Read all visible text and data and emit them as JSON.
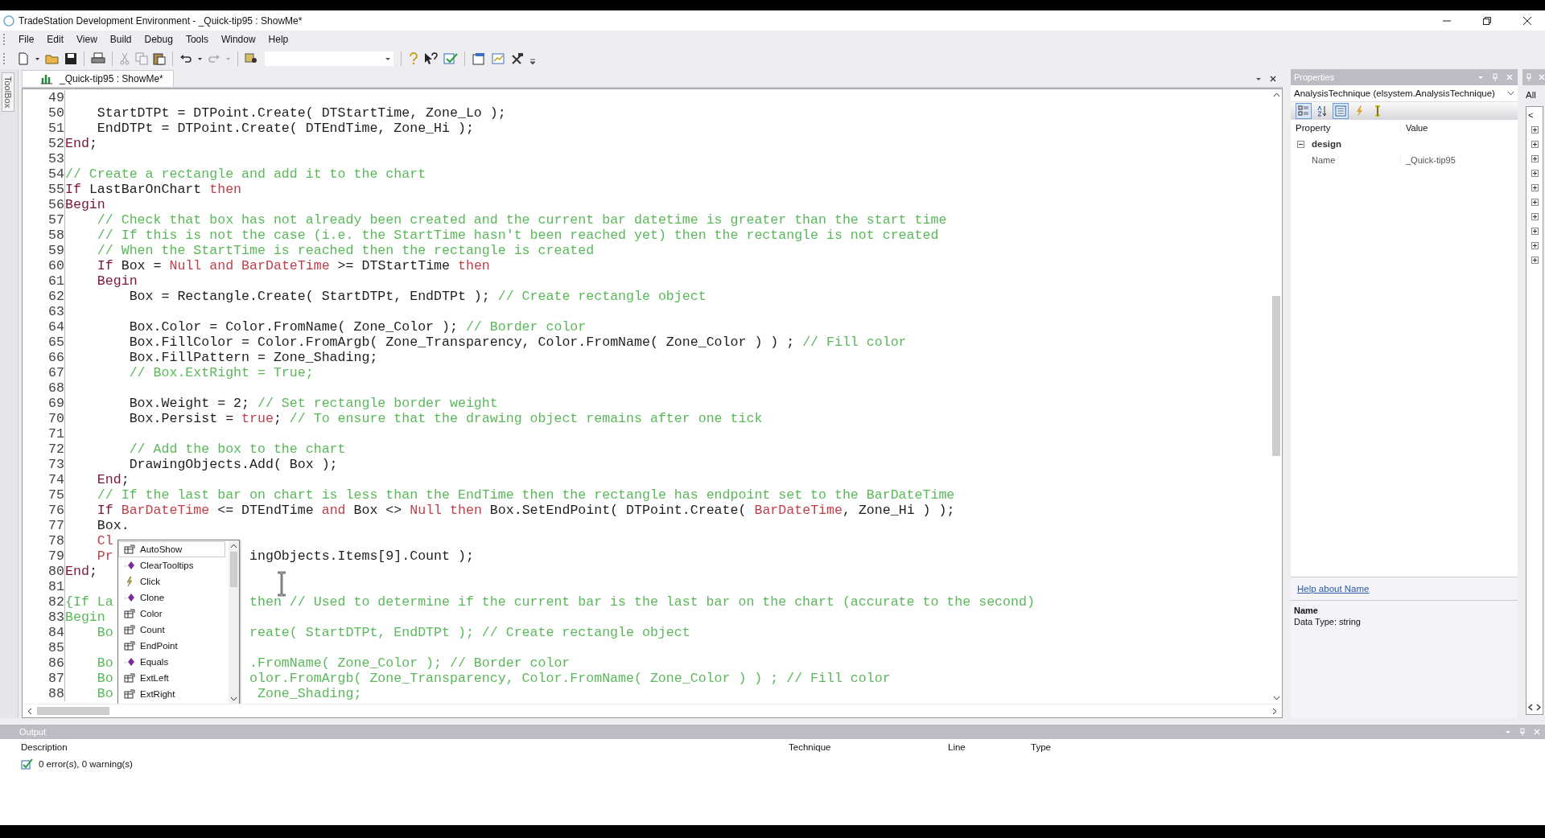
{
  "window": {
    "title": "TradeStation Development Environment - _Quick-tip95 : ShowMe*"
  },
  "menu": [
    "File",
    "Edit",
    "View",
    "Build",
    "Debug",
    "Tools",
    "Window",
    "Help"
  ],
  "toolbox": {
    "label": "ToolBox"
  },
  "editor": {
    "tab": {
      "label": "_Quick-tip95 : ShowMe*",
      "selected": true
    },
    "lines": [
      {
        "number": "49"
      },
      {
        "number": "50",
        "segments": [
          {
            "text": "    StartDTPt = DTPoint.Create( DTStartTime, Zone_Lo );",
            "kind": "code"
          }
        ]
      },
      {
        "number": "51",
        "segments": [
          {
            "text": "    EndDTPt = DTPoint.Create( DTEndTime, Zone_Hi );",
            "kind": "code"
          }
        ]
      },
      {
        "number": "52",
        "segments": [
          {
            "text": "End",
            "kind": "keyword"
          },
          {
            "text": ";",
            "kind": "code"
          }
        ]
      },
      {
        "number": "53"
      },
      {
        "number": "54",
        "segments": [
          {
            "text": "// Create a rectangle and add it to the chart",
            "kind": "comment"
          }
        ]
      },
      {
        "number": "55",
        "segments": [
          {
            "text": "If",
            "kind": "keyword"
          },
          {
            "text": " LastBarOnChart ",
            "kind": "code"
          },
          {
            "text": "then",
            "kind": "reserved"
          }
        ]
      },
      {
        "number": "56",
        "segments": [
          {
            "text": "Begin",
            "kind": "keyword"
          }
        ]
      },
      {
        "number": "57",
        "segments": [
          {
            "text": "    // Check that box has not already been created and the current bar datetime is greater than the start time",
            "kind": "comment"
          }
        ]
      },
      {
        "number": "58",
        "segments": [
          {
            "text": "    // If this is not the case (i.e. the StartTime hasn't been reached yet) then the rectangle is not created",
            "kind": "comment"
          }
        ]
      },
      {
        "number": "59",
        "segments": [
          {
            "text": "    // When the StartTime is reached then the rectangle is created",
            "kind": "comment"
          }
        ]
      },
      {
        "number": "60",
        "segments": [
          {
            "text": "    If",
            "kind": "keyword"
          },
          {
            "text": " Box = ",
            "kind": "code"
          },
          {
            "text": "Null and BarDateTime",
            "kind": "reserved"
          },
          {
            "text": " >= DTStartTime ",
            "kind": "code"
          },
          {
            "text": "then",
            "kind": "reserved"
          }
        ]
      },
      {
        "number": "61",
        "segments": [
          {
            "text": "    Begin",
            "kind": "keyword"
          }
        ]
      },
      {
        "number": "62",
        "segments": [
          {
            "text": "        Box = Rectangle.Create( StartDTPt, EndDTPt ); ",
            "kind": "code"
          },
          {
            "text": "// Create rectangle object",
            "kind": "comment"
          }
        ]
      },
      {
        "number": "63"
      },
      {
        "number": "64",
        "segments": [
          {
            "text": "        Box.Color = Color.FromName( Zone_Color ); ",
            "kind": "code"
          },
          {
            "text": "// Border color",
            "kind": "comment"
          }
        ]
      },
      {
        "number": "65",
        "segments": [
          {
            "text": "        Box.FillColor = Color.FromArgb( Zone_Transparency, Color.FromName( Zone_Color ) ) ; ",
            "kind": "code"
          },
          {
            "text": "// Fill color",
            "kind": "comment"
          }
        ]
      },
      {
        "number": "66",
        "segments": [
          {
            "text": "        Box.FillPattern = Zone_Shading;",
            "kind": "code"
          }
        ]
      },
      {
        "number": "67",
        "segments": [
          {
            "text": "        // Box.ExtRight = True;",
            "kind": "comment"
          }
        ]
      },
      {
        "number": "68"
      },
      {
        "number": "69",
        "segments": [
          {
            "text": "        Box.Weight = 2; ",
            "kind": "code"
          },
          {
            "text": "// Set rectangle border weight",
            "kind": "comment"
          }
        ]
      },
      {
        "number": "70",
        "segments": [
          {
            "text": "        Box.Persist = ",
            "kind": "code"
          },
          {
            "text": "true",
            "kind": "reserved"
          },
          {
            "text": "; ",
            "kind": "code"
          },
          {
            "text": "// To ensure that the drawing object remains after one tick",
            "kind": "comment"
          }
        ]
      },
      {
        "number": "71"
      },
      {
        "number": "72",
        "segments": [
          {
            "text": "        // Add the box to the chart",
            "kind": "comment"
          }
        ]
      },
      {
        "number": "73",
        "segments": [
          {
            "text": "        DrawingObjects.Add( Box );",
            "kind": "code"
          }
        ]
      },
      {
        "number": "74",
        "segments": [
          {
            "text": "    End",
            "kind": "keyword"
          },
          {
            "text": ";",
            "kind": "code"
          }
        ]
      },
      {
        "number": "75",
        "segments": [
          {
            "text": "    // If the last bar on chart is less than the EndTime then the rectangle has endpoint set to the BarDateTime",
            "kind": "comment"
          }
        ]
      },
      {
        "number": "76",
        "segments": [
          {
            "text": "    If",
            "kind": "keyword"
          },
          {
            "text": " BarDateTime",
            "kind": "reserved"
          },
          {
            "text": " <= DTEndTime ",
            "kind": "code"
          },
          {
            "text": "and",
            "kind": "reserved"
          },
          {
            "text": " Box <> ",
            "kind": "code"
          },
          {
            "text": "Null then",
            "kind": "reserved"
          },
          {
            "text": " Box.SetEndPoint( DTPoint.Create( ",
            "kind": "code"
          },
          {
            "text": "BarDateTime",
            "kind": "reserved"
          },
          {
            "text": ", Zone_Hi ) );",
            "kind": "code"
          }
        ]
      },
      {
        "number": "77",
        "segments": [
          {
            "text": "    Box.",
            "kind": "code"
          }
        ]
      },
      {
        "number": "78",
        "segments": [
          {
            "text": "    Cl",
            "kind": "reserved"
          }
        ]
      },
      {
        "number": "79",
        "segments": [
          {
            "text": "    Pr",
            "kind": "reserved"
          }
        ],
        "after_popup": [
          {
            "text": "ingObjects.Items[9].Count );",
            "kind": "code"
          }
        ]
      },
      {
        "number": "80",
        "segments": [
          {
            "text": "End",
            "kind": "keyword"
          },
          {
            "text": ";",
            "kind": "code"
          }
        ]
      },
      {
        "number": "81"
      },
      {
        "number": "82",
        "segments": [
          {
            "text": "{If La",
            "kind": "comment"
          }
        ],
        "after_popup": [
          {
            "text": "then // Used to determine if the current bar is the last bar on the chart (accurate to the second)",
            "kind": "comment"
          }
        ]
      },
      {
        "number": "83",
        "segments": [
          {
            "text": "Begin",
            "kind": "comment"
          }
        ]
      },
      {
        "number": "84",
        "segments": [
          {
            "text": "    Bo",
            "kind": "comment"
          }
        ],
        "after_popup": [
          {
            "text": "reate( StartDTPt, EndDTPt ); // Create rectangle object",
            "kind": "comment"
          }
        ]
      },
      {
        "number": "85"
      },
      {
        "number": "86",
        "segments": [
          {
            "text": "    Bo",
            "kind": "comment"
          }
        ],
        "after_popup": [
          {
            "text": ".FromName( Zone_Color ); // Border color",
            "kind": "comment"
          }
        ]
      },
      {
        "number": "87",
        "segments": [
          {
            "text": "    Bo",
            "kind": "comment"
          }
        ],
        "after_popup": [
          {
            "text": "olor.FromArgb( Zone_Transparency, Color.FromName( Zone_Color ) ) ; // Fill color",
            "kind": "comment"
          }
        ]
      },
      {
        "number": "88",
        "segments": [
          {
            "text": "    Bo",
            "kind": "comment"
          }
        ],
        "after_popup": [
          {
            "text": " Zone_Shading;",
            "kind": "comment"
          }
        ]
      }
    ],
    "completion": {
      "items": [
        {
          "label": "AutoShow",
          "kind": "property",
          "selected": true
        },
        {
          "label": "ClearTooltips",
          "kind": "method",
          "selected": false
        },
        {
          "label": "Click",
          "kind": "event",
          "selected": false
        },
        {
          "label": "Clone",
          "kind": "method",
          "selected": false
        },
        {
          "label": "Color",
          "kind": "property",
          "selected": false
        },
        {
          "label": "Count",
          "kind": "property",
          "selected": false
        },
        {
          "label": "EndPoint",
          "kind": "property",
          "selected": false
        },
        {
          "label": "Equals",
          "kind": "method",
          "selected": false
        },
        {
          "label": "ExtLeft",
          "kind": "property",
          "selected": false
        },
        {
          "label": "ExtRight",
          "kind": "property",
          "selected": false
        }
      ]
    }
  },
  "properties": {
    "title": "Properties",
    "object": "AnalysisTechnique (elsystem.AnalysisTechnique)",
    "tools": [
      {
        "kind": "categorized",
        "selected": true
      },
      {
        "kind": "alphabetical",
        "selected": false
      },
      {
        "kind": "pages",
        "selected": true
      },
      {
        "kind": "events",
        "selected": false
      },
      {
        "kind": "cursor",
        "selected": false
      }
    ],
    "columns": [
      "Property",
      "Value"
    ],
    "groups": [
      {
        "name": "design",
        "expanded": true,
        "rows": [
          {
            "property": "Name",
            "value": "_Quick-tip95"
          }
        ]
      }
    ],
    "help_link": "Help about Name",
    "description_title": "Name",
    "description": "Data Type: string"
  },
  "side_strip": {
    "tab": "All",
    "button": "<"
  },
  "output": {
    "title": "Output",
    "columns": [
      "Description",
      "Technique",
      "Line",
      "Type"
    ],
    "rows": [
      {
        "description": "0 error(s), 0 warning(s)"
      }
    ]
  }
}
